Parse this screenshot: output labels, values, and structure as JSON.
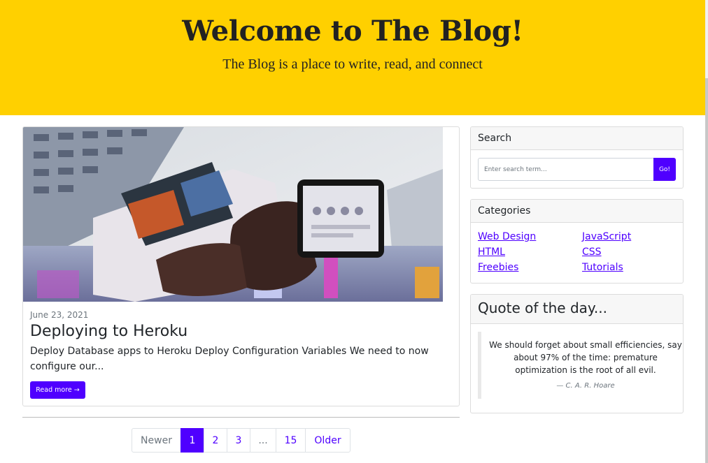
{
  "header": {
    "title": "Welcome to The Blog!",
    "subtitle": "The Blog is a place to write, read, and connect"
  },
  "post": {
    "date": "June 23, 2021",
    "title": "Deploying to Heroku",
    "excerpt": "Deploy Database apps to Heroku Deploy Configuration Variables We need to now configure our...",
    "read_more_label": "Read more →",
    "image_icon": "phone-in-hand-photo"
  },
  "pagination": {
    "newer_label": "Newer",
    "pages": [
      "1",
      "2",
      "3",
      "...",
      "15"
    ],
    "active_page": "1",
    "older_label": "Older"
  },
  "sidebar": {
    "search": {
      "title": "Search",
      "placeholder": "Enter search term...",
      "button_label": "Go!"
    },
    "categories": {
      "title": "Categories",
      "left": [
        "Web Design",
        "HTML",
        "Freebies"
      ],
      "right": [
        "JavaScript",
        "CSS",
        "Tutorials"
      ]
    },
    "quote": {
      "title": "Quote of the day...",
      "text": "We should forget about small efficiencies, say about 97% of the time: premature optimization is the root of all evil.",
      "author": "— C. A. R. Hoare"
    }
  },
  "colors": {
    "header_bg": "#ffd000",
    "accent": "#4f00ff",
    "border": "#dcdcdc"
  }
}
